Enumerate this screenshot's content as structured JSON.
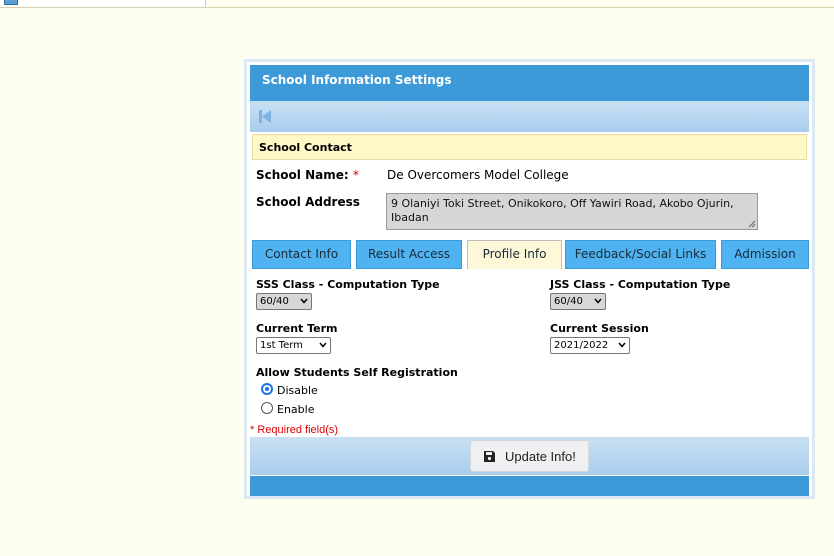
{
  "panel": {
    "title": "School Information Settings",
    "section_title": "School Contact",
    "school_name_label": "School Name:",
    "required_mark": "*",
    "school_name_value": "De Overcomers Model College",
    "school_address_label": "School Address",
    "school_address_value": "9 Olaniyi Toki Street, Onikokoro, Off Yawiri Road, Akobo Ojurin, Ibadan"
  },
  "tabs": [
    {
      "label": "Contact Info",
      "active": false
    },
    {
      "label": "Result Access",
      "active": false
    },
    {
      "label": "Profile Info",
      "active": true
    },
    {
      "label": "Feedback/Social Links",
      "active": false
    },
    {
      "label": "Admission",
      "active": false
    }
  ],
  "profile": {
    "sss_label": "SSS Class - Computation Type",
    "sss_value": "60/40",
    "jss_label": "JSS Class - Computation Type",
    "jss_value": "60/40",
    "term_label": "Current Term",
    "term_value": "1st Term",
    "session_label": "Current Session",
    "session_value": "2021/2022",
    "self_reg_label": "Allow Students Self Registration",
    "options": [
      {
        "label": "Disable",
        "selected": true
      },
      {
        "label": "Enable",
        "selected": false
      }
    ]
  },
  "footer": {
    "required_note": "* Required field(s)",
    "update_label": "Update Info!"
  },
  "colors": {
    "header_blue": "#3c9ad8",
    "tab_blue": "#4fb3f2",
    "section_yellow": "#fdf8c6",
    "required_red": "#dd0000"
  },
  "icons": {
    "nav_first": "first-page-icon",
    "save": "floppy-disk-icon"
  }
}
